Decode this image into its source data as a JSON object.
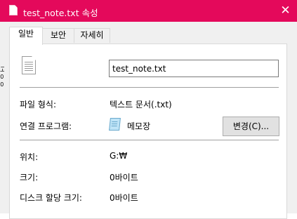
{
  "window": {
    "title": "test_note.txt 속성",
    "close_glyph": "✕"
  },
  "background_strip": {
    "text": "고\n이\n이"
  },
  "tabs": [
    {
      "label": "일반",
      "active": true
    },
    {
      "label": "보안",
      "active": false
    },
    {
      "label": "자세히",
      "active": false
    }
  ],
  "general": {
    "file_name": "test_note.txt",
    "file_type_label": "파일 형식:",
    "file_type_value": "텍스트 문서(.txt)",
    "open_with_label": "연결 프로그램:",
    "open_with_value": "메모장",
    "change_button": "변경(C)...",
    "location_label": "위치:",
    "location_value": "G:₩",
    "size_label": "크기:",
    "size_value": "0바이트",
    "size_on_disk_label": "디스크 할당 크기:",
    "size_on_disk_value": "0바이트"
  },
  "icons": {
    "title_icon": "text-file-icon",
    "file_icon": "text-file-icon",
    "app_icon": "notepad-icon"
  },
  "colors": {
    "titlebar": "#e4095b",
    "dialog_bg": "#f0f0f0",
    "panel_bg": "#ffffff"
  }
}
